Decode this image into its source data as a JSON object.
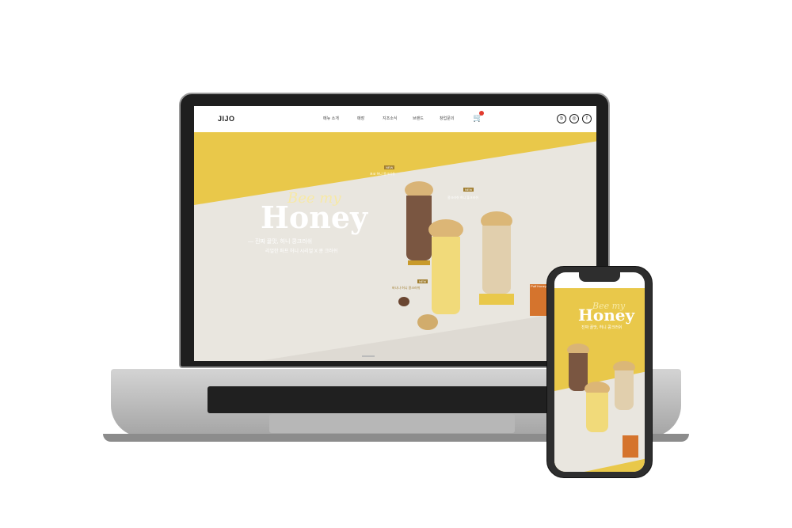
{
  "site": {
    "logo": "JIJO",
    "menu": [
      "메뉴 소개",
      "매장",
      "지조소식",
      "브랜드",
      "창업문의"
    ],
    "cart_count": "0",
    "social": [
      "blog-icon",
      "instagram-icon",
      "facebook-icon"
    ]
  },
  "hero": {
    "script_title": "Bee my",
    "title": "Honey",
    "tagline": "— 진짜 꿀맛, 허니 콩크러쉬",
    "subtitle": "리얼한 퍼프 허니 시리얼 X 콩 크러쉬",
    "product_labels": [
      {
        "badge": "NEW",
        "name": "초코 허니 콩크러쉬"
      },
      {
        "badge": "NEW",
        "name": "콩크러쉬 허니 퓨크러쉬"
      },
      {
        "badge": "NEW",
        "name": "바나나 허니 콩크러쉬"
      }
    ],
    "cereal_box": "Puff Honey"
  },
  "phone": {
    "script_title": "Bee my",
    "title": "Honey",
    "tagline": "진짜 꿀맛, 허니 콩크러쉬"
  },
  "colors": {
    "hero_yellow": "#e9c84a",
    "hero_floor": "#e9e6df",
    "badge_gold": "#a07d2e",
    "cart_badge": "#e23b2e"
  }
}
